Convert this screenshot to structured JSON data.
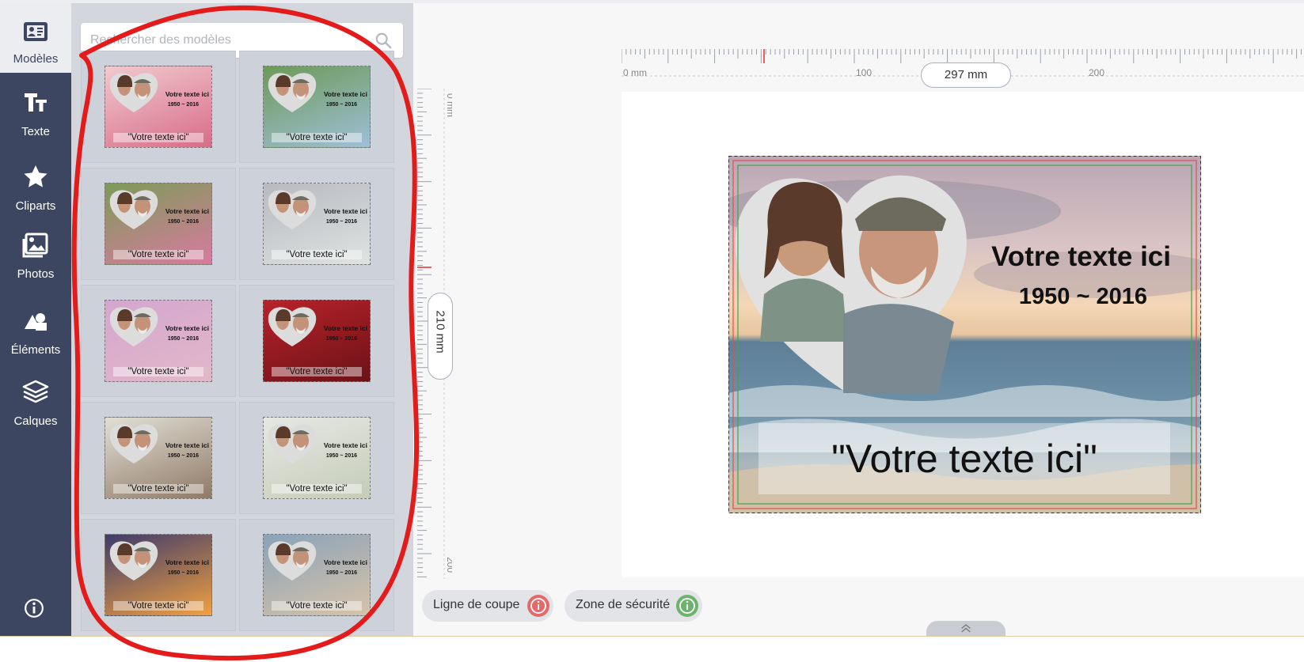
{
  "sidebar": {
    "items": [
      {
        "label": "Modèles",
        "icon": "id-card-icon",
        "active": true
      },
      {
        "label": "Texte",
        "icon": "text-icon",
        "active": false
      },
      {
        "label": "Cliparts",
        "icon": "star-icon",
        "active": false
      },
      {
        "label": "Photos",
        "icon": "image-icon",
        "active": false
      },
      {
        "label": "Éléments",
        "icon": "shapes-icon",
        "active": false
      },
      {
        "label": "Calques",
        "icon": "layers-icon",
        "active": false
      }
    ],
    "info_icon": "info-icon"
  },
  "templates": {
    "search_placeholder": "Rechercher des modèles",
    "items": [
      {
        "name": "Votre texte ici",
        "dates": "1950 ~ 2016",
        "quote": "\"Votre texte ici\"",
        "theme": "pink flowers"
      },
      {
        "name": "Votre texte ici",
        "dates": "1950 ~ 2016",
        "quote": "\"Votre texte ici\"",
        "theme": "mountain river"
      },
      {
        "name": "Votre texte ici",
        "dates": "1950 ~ 2016",
        "quote": "\"Votre texte ici\"",
        "theme": "tulip path"
      },
      {
        "name": "Votre texte ici",
        "dates": "1950 ~ 2016",
        "quote": "\"Votre texte ici\"",
        "theme": "white flowers"
      },
      {
        "name": "Votre texte ici",
        "dates": "1950 ~ 2016",
        "quote": "\"Votre texte ici\"",
        "theme": "lavender"
      },
      {
        "name": "Votre texte ici",
        "dates": "1950 ~ 2016",
        "quote": "\"Votre texte ici\"",
        "theme": "red rose"
      },
      {
        "name": "Votre texte ici",
        "dates": "1950 ~ 2016",
        "quote": "\"Votre texte ici\"",
        "theme": "stones"
      },
      {
        "name": "Votre texte ici",
        "dates": "1950 ~ 2016",
        "quote": "\"Votre texte ici\"",
        "theme": "baby breath"
      },
      {
        "name": "Votre texte ici",
        "dates": "1950 ~ 2016",
        "quote": "\"Votre texte ici\"",
        "theme": "sunset"
      },
      {
        "name": "Votre texte ici",
        "dates": "1950 ~ 2016",
        "quote": "\"Votre texte ici\"",
        "theme": "sea"
      }
    ]
  },
  "canvas": {
    "width_label": "297 mm",
    "height_label": "210 mm",
    "ruler": {
      "h_labels": [
        "0 mm",
        "100",
        "200"
      ],
      "v_labels": [
        "0 mm",
        "200"
      ]
    },
    "design": {
      "name": "Votre texte ici",
      "dates": "1950 ~ 2016",
      "quote": "\"Votre texte ici\""
    }
  },
  "toggles": [
    {
      "label": "Ligne de coupe",
      "color": "#e46a6a"
    },
    {
      "label": "Zone de sécurité",
      "color": "#6cb36c"
    }
  ],
  "colors": {
    "sidebar": "#3d4660",
    "panel": "#d3d6dd",
    "annotation": "#e31b1b"
  }
}
